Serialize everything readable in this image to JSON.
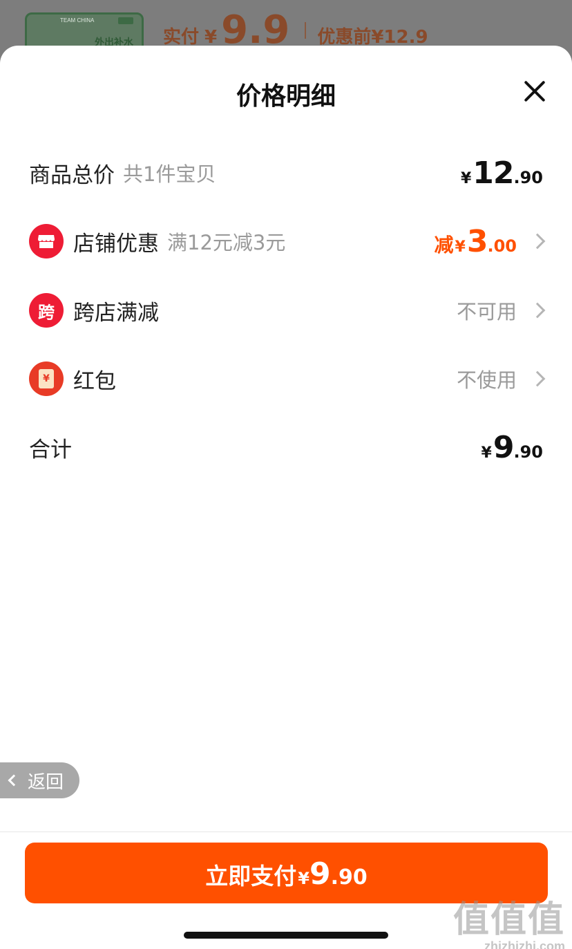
{
  "background": {
    "thumbnail_team": "TEAM CHINA",
    "thumbnail_text": "外出补水",
    "paid_label": "实付",
    "paid_yen": "¥",
    "paid_amount": "9.9",
    "original_label": "优惠前",
    "original_price": "¥12.9"
  },
  "sheet": {
    "title": "价格明细"
  },
  "rows": {
    "subtotal": {
      "label": "商品总价",
      "sub": "共1件宝贝",
      "yen": "¥",
      "int": "12",
      "dec": ".90"
    },
    "store_discount": {
      "label": "店铺优惠",
      "sub": "满12元减3元",
      "prefix": "减",
      "yen": "¥",
      "int": "3",
      "dec": ".00",
      "icon": "store-icon"
    },
    "cross_store": {
      "label": "跨店满减",
      "status": "不可用",
      "icon_text": "跨"
    },
    "red_packet": {
      "label": "红包",
      "status": "不使用",
      "icon_text": "¥"
    },
    "total": {
      "label": "合计",
      "yen": "¥",
      "int": "9",
      "dec": ".90"
    }
  },
  "back": {
    "label": "返回"
  },
  "pay_button": {
    "label": "立即支付",
    "yen": "¥",
    "int": "9",
    "dec": ".90"
  },
  "watermark": {
    "cn": "值值值",
    "en": "zhizhizhi.com"
  },
  "colors": {
    "accent": "#ff5000",
    "icon_red": "#ee1c35"
  }
}
